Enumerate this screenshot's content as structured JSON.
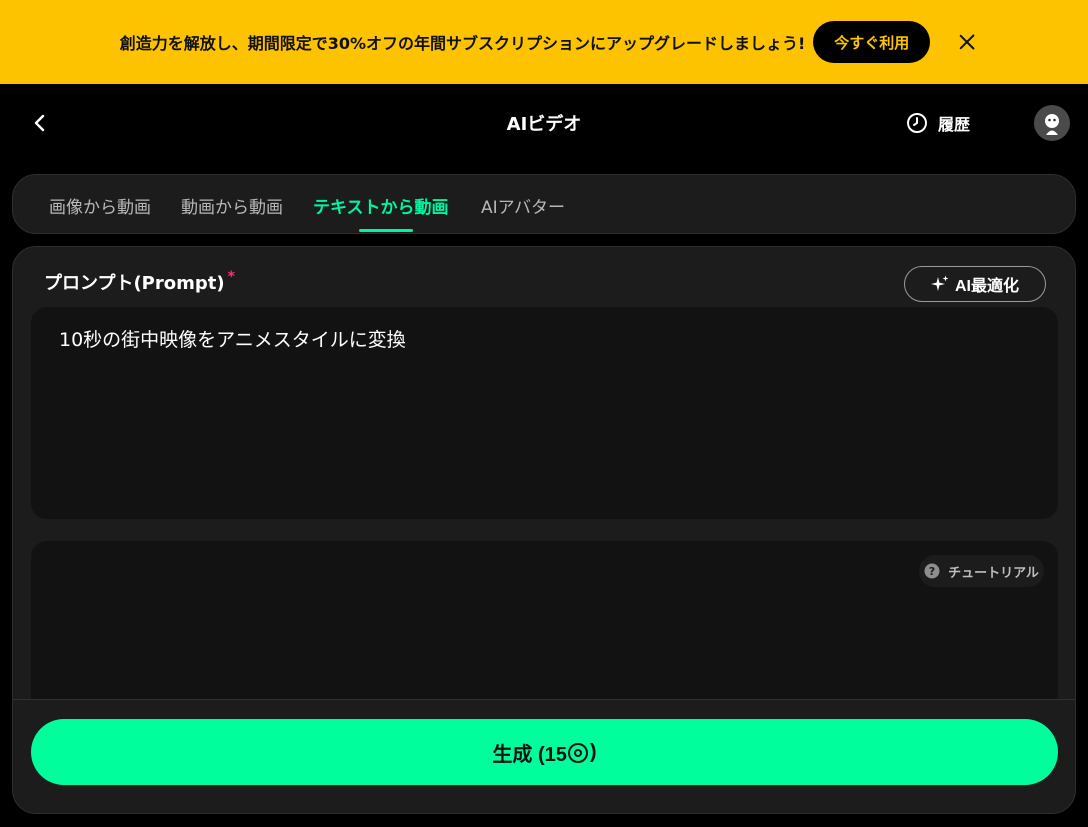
{
  "banner": {
    "text": "創造力を解放し、期間限定で30%オフの年間サブスクリプションにアップグレードしましょう!",
    "cta_label": "今すぐ利用",
    "background": "#fdc300"
  },
  "header": {
    "title": "AIビデオ",
    "history_label": "履歴"
  },
  "tabs": [
    {
      "label": "画像から動画",
      "active": false
    },
    {
      "label": "動画から動画",
      "active": false
    },
    {
      "label": "テキストから動画",
      "active": true
    },
    {
      "label": "AIアバター",
      "active": false
    }
  ],
  "prompt": {
    "label": "プロンプト(Prompt)",
    "required_mark": "*",
    "ai_optimize_label": "AI最適化",
    "value": "10秒の街中映像をアニメスタイルに変換"
  },
  "tutorial_label": "チュートリアル",
  "generate": {
    "label_prefix": "生成 (15",
    "label_suffix": ")"
  },
  "colors": {
    "accent": "#00f5a0",
    "generate_button": "#00ff9c",
    "required": "#ff2d6f"
  }
}
